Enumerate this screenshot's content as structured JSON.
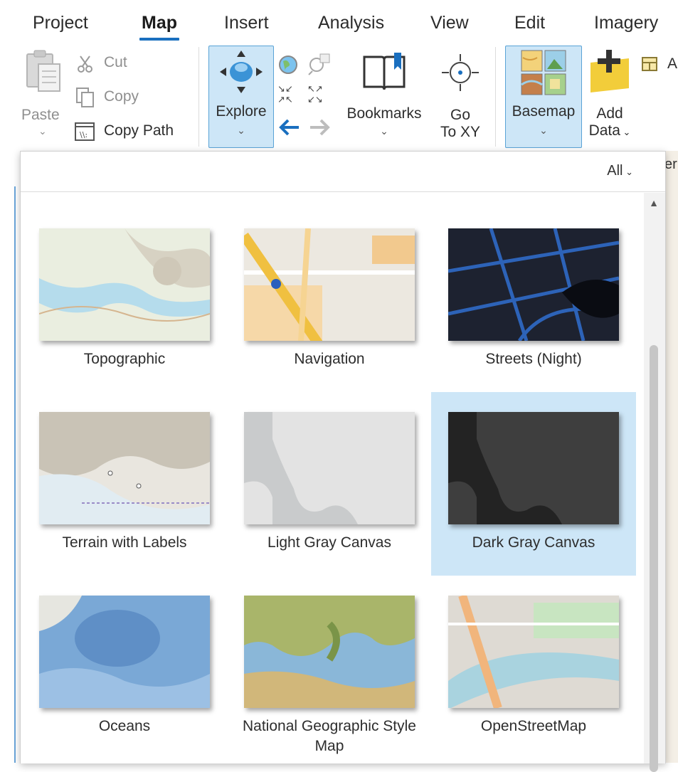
{
  "tabs": [
    {
      "label": "Project"
    },
    {
      "label": "Map",
      "active": true
    },
    {
      "label": "Insert"
    },
    {
      "label": "Analysis"
    },
    {
      "label": "View"
    },
    {
      "label": "Edit"
    },
    {
      "label": "Imagery"
    }
  ],
  "clipboard": {
    "paste": "Paste",
    "cut": "Cut",
    "copy": "Copy",
    "copy_path": "Copy Path"
  },
  "navigate": {
    "explore": "Explore",
    "bookmarks": "Bookmarks",
    "go_to_xy_line1": "Go",
    "go_to_xy_line2": "To XY"
  },
  "layer": {
    "basemap": "Basemap",
    "add_data_line1": "Add",
    "add_data_line2": "Data",
    "partial_label": "A",
    "partial_right": "er"
  },
  "gallery": {
    "filter": "All",
    "items": [
      {
        "label": "Topographic"
      },
      {
        "label": "Navigation"
      },
      {
        "label": "Streets (Night)"
      },
      {
        "label": "Terrain with Labels"
      },
      {
        "label": "Light Gray Canvas"
      },
      {
        "label": "Dark Gray Canvas",
        "selected": true
      },
      {
        "label": "Oceans"
      },
      {
        "label": "National Geographic Style Map"
      },
      {
        "label": "OpenStreetMap"
      }
    ]
  },
  "colors": {
    "accent": "#1a6fbf",
    "selected_bg": "#cde6f7"
  }
}
